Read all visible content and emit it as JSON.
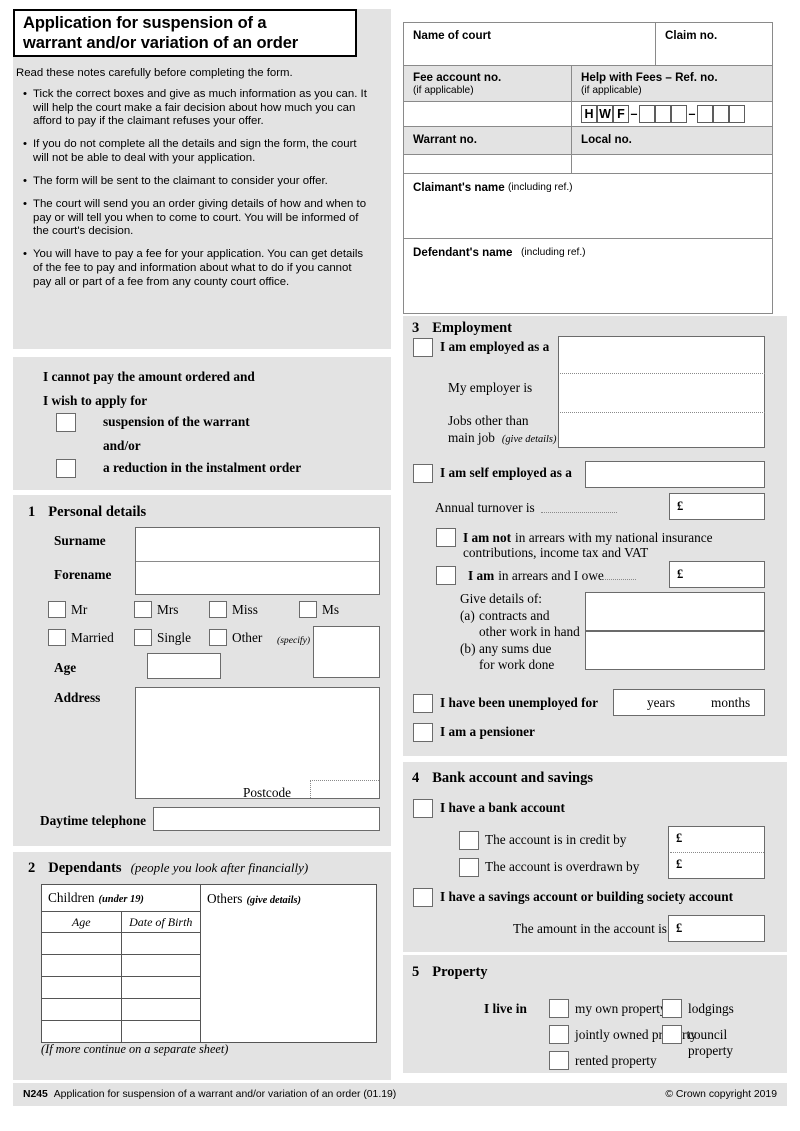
{
  "form": {
    "title": "Application for suspension of a warrant and/or variation of an order",
    "title_line1": "Application for suspension of a",
    "title_line2": "warrant and/or variation of an order",
    "intro": "Read these notes carefully before completing the form.",
    "notes": [
      "Tick the correct boxes and give as much information as you can. It will help the court make a fair decision about how much you can afford to pay if the claimant refuses your offer.",
      "If you do not complete all the details and sign the form, the court will not be able to deal with your application.",
      "The form will be sent to the claimant to consider your offer.",
      "The court will send you an order giving details of how and when to pay or will tell you when to come to court. You will be informed of the court's decision.",
      "You will have to pay a fee for your application. You can get details of the fee to pay and information about what to do if you cannot pay all or part of a fee from any county court office."
    ]
  },
  "apply": {
    "line1": "I cannot pay the amount ordered and",
    "line2": "I wish to apply for",
    "option1": "suspension of the warrant",
    "andor": "and/or",
    "option2": "a reduction in the instalment order"
  },
  "court_header": {
    "name_of_court": "Name of court",
    "claim_no": "Claim no.",
    "fee_account_no": "Fee account no.",
    "fee_account_note": "(if applicable)",
    "help_with_fees": "Help with Fees – Ref. no.",
    "help_with_fees_note": "(if applicable)",
    "hwf_prefix": [
      "H",
      "W",
      "F"
    ],
    "hwf_dash": "–",
    "hwf_group1_boxes": 3,
    "hwf_group2_boxes": 3,
    "warrant_no": "Warrant no.",
    "local_no": "Local no.",
    "claimants_name": "Claimant's name",
    "claimants_name_note": "(including ref.)",
    "defendants_name": "Defendant's name",
    "defendants_name_note": "(including ref.)",
    "values": {
      "name_of_court": "",
      "claim_no": "",
      "fee_account_no": "",
      "warrant_no": "",
      "local_no": "",
      "claimants_name": "",
      "defendants_name": ""
    }
  },
  "section1": {
    "number": "1",
    "heading": "Personal details",
    "surname_label": "Surname",
    "forename_label": "Forename",
    "titles": [
      "Mr",
      "Mrs",
      "Miss",
      "Ms"
    ],
    "status": [
      "Married",
      "Single",
      "Other"
    ],
    "other_note": "(specify)",
    "age_label": "Age",
    "address_label": "Address",
    "postcode_label": "Postcode",
    "telephone_label": "Daytime telephone",
    "values": {
      "surname": "",
      "forename": "",
      "age": "",
      "other": "",
      "address": "",
      "postcode": "",
      "telephone": ""
    }
  },
  "section2": {
    "number": "2",
    "heading": "Dependants",
    "heading_note": "(people you look after financially)",
    "children_label": "Children",
    "children_note": "(under 19)",
    "others_label": "Others",
    "others_note": "(give details)",
    "col_age": "Age",
    "col_dob": "Date of Birth",
    "rows": [
      {
        "age": "",
        "dob": ""
      },
      {
        "age": "",
        "dob": ""
      },
      {
        "age": "",
        "dob": ""
      },
      {
        "age": "",
        "dob": ""
      },
      {
        "age": "",
        "dob": ""
      }
    ],
    "others_value": "",
    "footnote": "(If more continue on a separate sheet)"
  },
  "section3": {
    "number": "3",
    "heading": "Employment",
    "employed_label": "I am employed as a",
    "employer_label": "My employer is",
    "other_jobs_label_line1": "Jobs other than",
    "other_jobs_label_line2": "main job",
    "other_jobs_note": "(give details)",
    "self_employed_label": "I am self employed as a",
    "turnover_label": "Annual turnover is",
    "not_arrears_bold": "I am not",
    "not_arrears_rest_line1": "in arrears with my national insurance",
    "not_arrears_rest_line2": "contributions, income tax and VAT",
    "arrears_bold": "I am",
    "arrears_rest": "in arrears and I owe",
    "give_details": "Give details of:",
    "detail_a_marker": "(a)",
    "detail_a_line1": "contracts and",
    "detail_a_line2": "other work in hand",
    "detail_b_marker": "(b)",
    "detail_b_line1": "any sums due",
    "detail_b_line2": "for work done",
    "unemployed_label": "I have been unemployed for",
    "years_label": "years",
    "months_label": "months",
    "pensioner_label": "I am a pensioner",
    "currency": "£",
    "values": {
      "employed_as": "",
      "employer": "",
      "other_jobs": "",
      "self_employed_as": "",
      "annual_turnover": "",
      "arrears_amount": "",
      "detail_a": "",
      "detail_b": "",
      "unemployed_years": "",
      "unemployed_months": ""
    }
  },
  "section4": {
    "number": "4",
    "heading": "Bank account and savings",
    "bank_account_label": "I have a bank account",
    "in_credit_label": "The account is in credit by",
    "overdrawn_label": "The account is overdrawn by",
    "savings_label": "I have a savings account or building society account",
    "amount_label": "The amount in the account is",
    "currency": "£",
    "values": {
      "in_credit": "",
      "overdrawn": "",
      "savings_amount": ""
    }
  },
  "section5": {
    "number": "5",
    "heading": "Property",
    "live_in_label": "I live in",
    "options_left": [
      "my own property",
      "jointly owned property",
      "rented property"
    ],
    "options_right": [
      "lodgings",
      "council property"
    ],
    "council_line1": "council",
    "council_line2": "property"
  },
  "footer": {
    "code": "N245",
    "text": "Application for suspension of a warrant and/or variation of an order (01.19)",
    "copyright": "© Crown copyright 2019"
  },
  "colors": {
    "panel_bg": "#e3e3e3",
    "field_border": "#6b6b6b",
    "text": "#000000",
    "page_bg": "#ffffff"
  }
}
